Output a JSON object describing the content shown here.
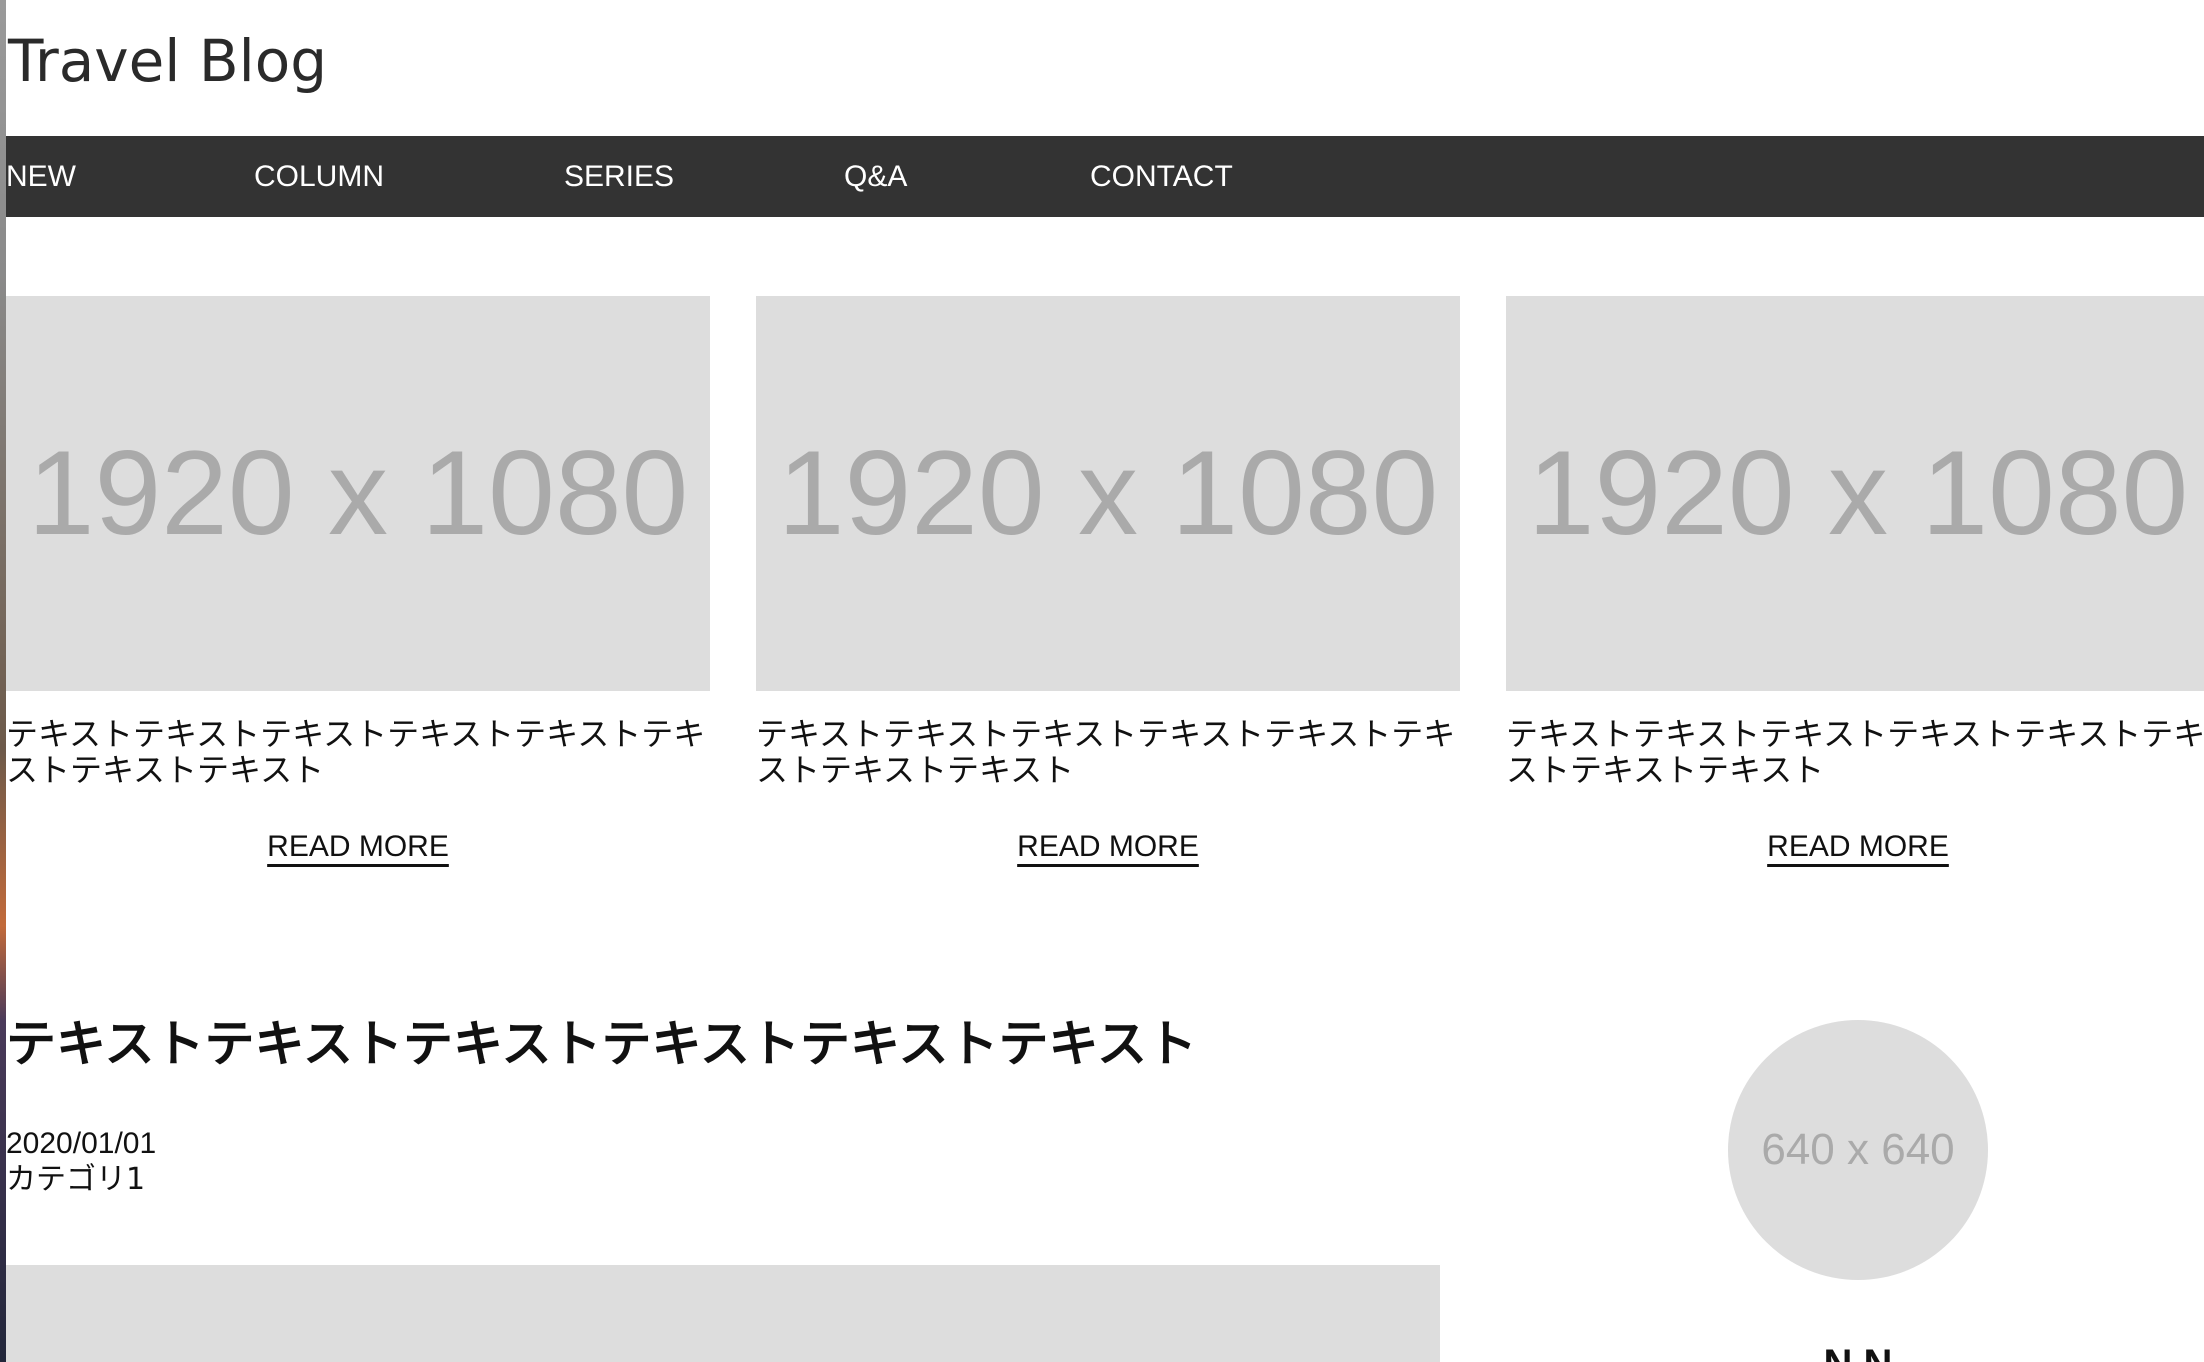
{
  "header": {
    "title": "Travel Blog"
  },
  "nav": {
    "items": [
      {
        "label": "NEW"
      },
      {
        "label": "COLUMN"
      },
      {
        "label": "SERIES"
      },
      {
        "label": "Q&A"
      },
      {
        "label": "CONTACT"
      }
    ]
  },
  "featured": {
    "cards": [
      {
        "image_label": "1920 x 1080",
        "text": "テキストテキストテキストテキストテキストテキストテキストテキスト",
        "read_more": "READ MORE"
      },
      {
        "image_label": "1920 x 1080",
        "text": "テキストテキストテキストテキストテキストテキストテキストテキスト",
        "read_more": "READ MORE"
      },
      {
        "image_label": "1920 x 1080",
        "text": "テキストテキストテキストテキストテキストテキストテキストテキスト",
        "read_more": "READ MORE"
      }
    ]
  },
  "article": {
    "title": "テキストテキストテキストテキストテキストテキスト",
    "date": "2020/01/01",
    "category": "カテゴリ1"
  },
  "profile": {
    "avatar_label": "640 x 640",
    "name": "N   N"
  },
  "colors": {
    "nav_background": "#333333",
    "placeholder_background": "#dddddd",
    "placeholder_text": "#aaaaaa"
  }
}
